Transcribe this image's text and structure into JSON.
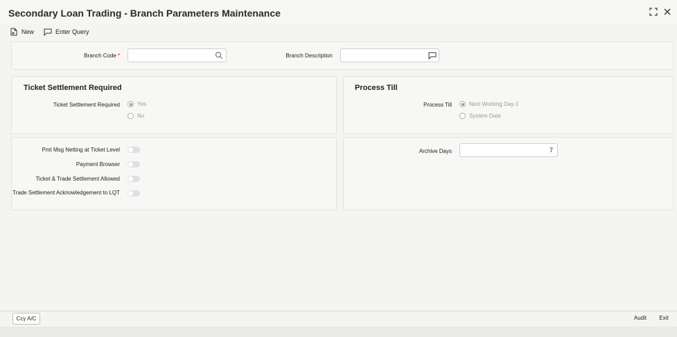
{
  "window": {
    "title": "Secondary Loan Trading - Branch Parameters Maintenance"
  },
  "toolbar": {
    "new_label": "New",
    "enter_query_label": "Enter Query"
  },
  "header": {
    "branch_code_label": "Branch Code",
    "branch_code_required": "*",
    "branch_code_value": "",
    "branch_description_label": "Branch Description",
    "branch_description_value": ""
  },
  "ticket_settlement": {
    "section_title": "Ticket Settlement Required",
    "field_label": "Ticket Settlement Required",
    "options": [
      "Yes",
      "No"
    ],
    "selected": "Yes"
  },
  "process_till": {
    "section_title": "Process Till",
    "field_label": "Process Till",
    "options": [
      "Next Working Day-1",
      "System Date"
    ],
    "selected": "Next Working Day-1"
  },
  "toggles": [
    {
      "label": "Pmt Msg Netting at Ticket Level",
      "on": false
    },
    {
      "label": "Payment Browser",
      "on": false
    },
    {
      "label": "Ticket & Trade Settlement Allowed",
      "on": false
    },
    {
      "label": "Trade Settlement Acknowledgement to LQT",
      "on": false
    }
  ],
  "archive": {
    "label": "Archive Days",
    "value": "7"
  },
  "footer": {
    "ccy_label": "Ccy A/C",
    "audit_label": "Audit",
    "exit_label": "Exit"
  }
}
